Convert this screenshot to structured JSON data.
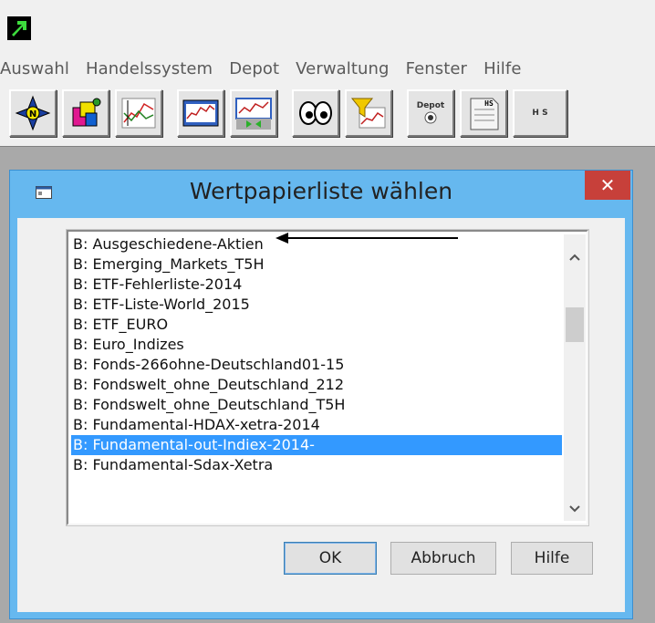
{
  "menu": [
    "Auswahl",
    "Handelssystem",
    "Depot",
    "Verwaltung",
    "Fenster",
    "Hilfe"
  ],
  "toolbar": {
    "depot_label": "Depot",
    "hs_label": "H S"
  },
  "dialog": {
    "title": "Wertpapierliste wählen",
    "close_glyph": "✕",
    "list_items": [
      "B: Ausgeschiedene-Aktien",
      "B: Emerging_Markets_T5H",
      "B: ETF-Fehlerliste-2014",
      "B: ETF-Liste-World_2015",
      "B: ETF_EURO",
      "B: Euro_Indizes",
      "B: Fonds-266ohne-Deutschland01-15",
      "B: Fondswelt_ohne_Deutschland_212",
      "B: Fondswelt_ohne_Deutschland_T5H",
      "B: Fundamental-HDAX-xetra-2014",
      "B: Fundamental-out-Indiex-2014-",
      "B: Fundamental-Sdax-Xetra"
    ],
    "selected_index": 10,
    "ok_label": "OK",
    "cancel_label": "Abbruch",
    "help_label": "Hilfe"
  },
  "colors": {
    "title_bar": "#66b8ef",
    "close_button": "#c7403a",
    "selection": "#3399ff"
  }
}
